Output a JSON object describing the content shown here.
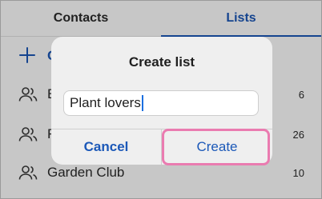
{
  "tabs": [
    {
      "label": "Contacts",
      "active": false
    },
    {
      "label": "Lists",
      "active": true
    }
  ],
  "create_row": {
    "label": "C"
  },
  "lists": [
    {
      "name": "E",
      "count": "6"
    },
    {
      "name": "F",
      "count": "26"
    },
    {
      "name": "Garden Club",
      "count": "10"
    }
  ],
  "dialog": {
    "title": "Create list",
    "input_value": "Plant lovers",
    "cancel_label": "Cancel",
    "create_label": "Create"
  },
  "colors": {
    "accent": "#1b58b8",
    "highlight": "#ea7bb0",
    "dialog_bg": "#efefef"
  }
}
